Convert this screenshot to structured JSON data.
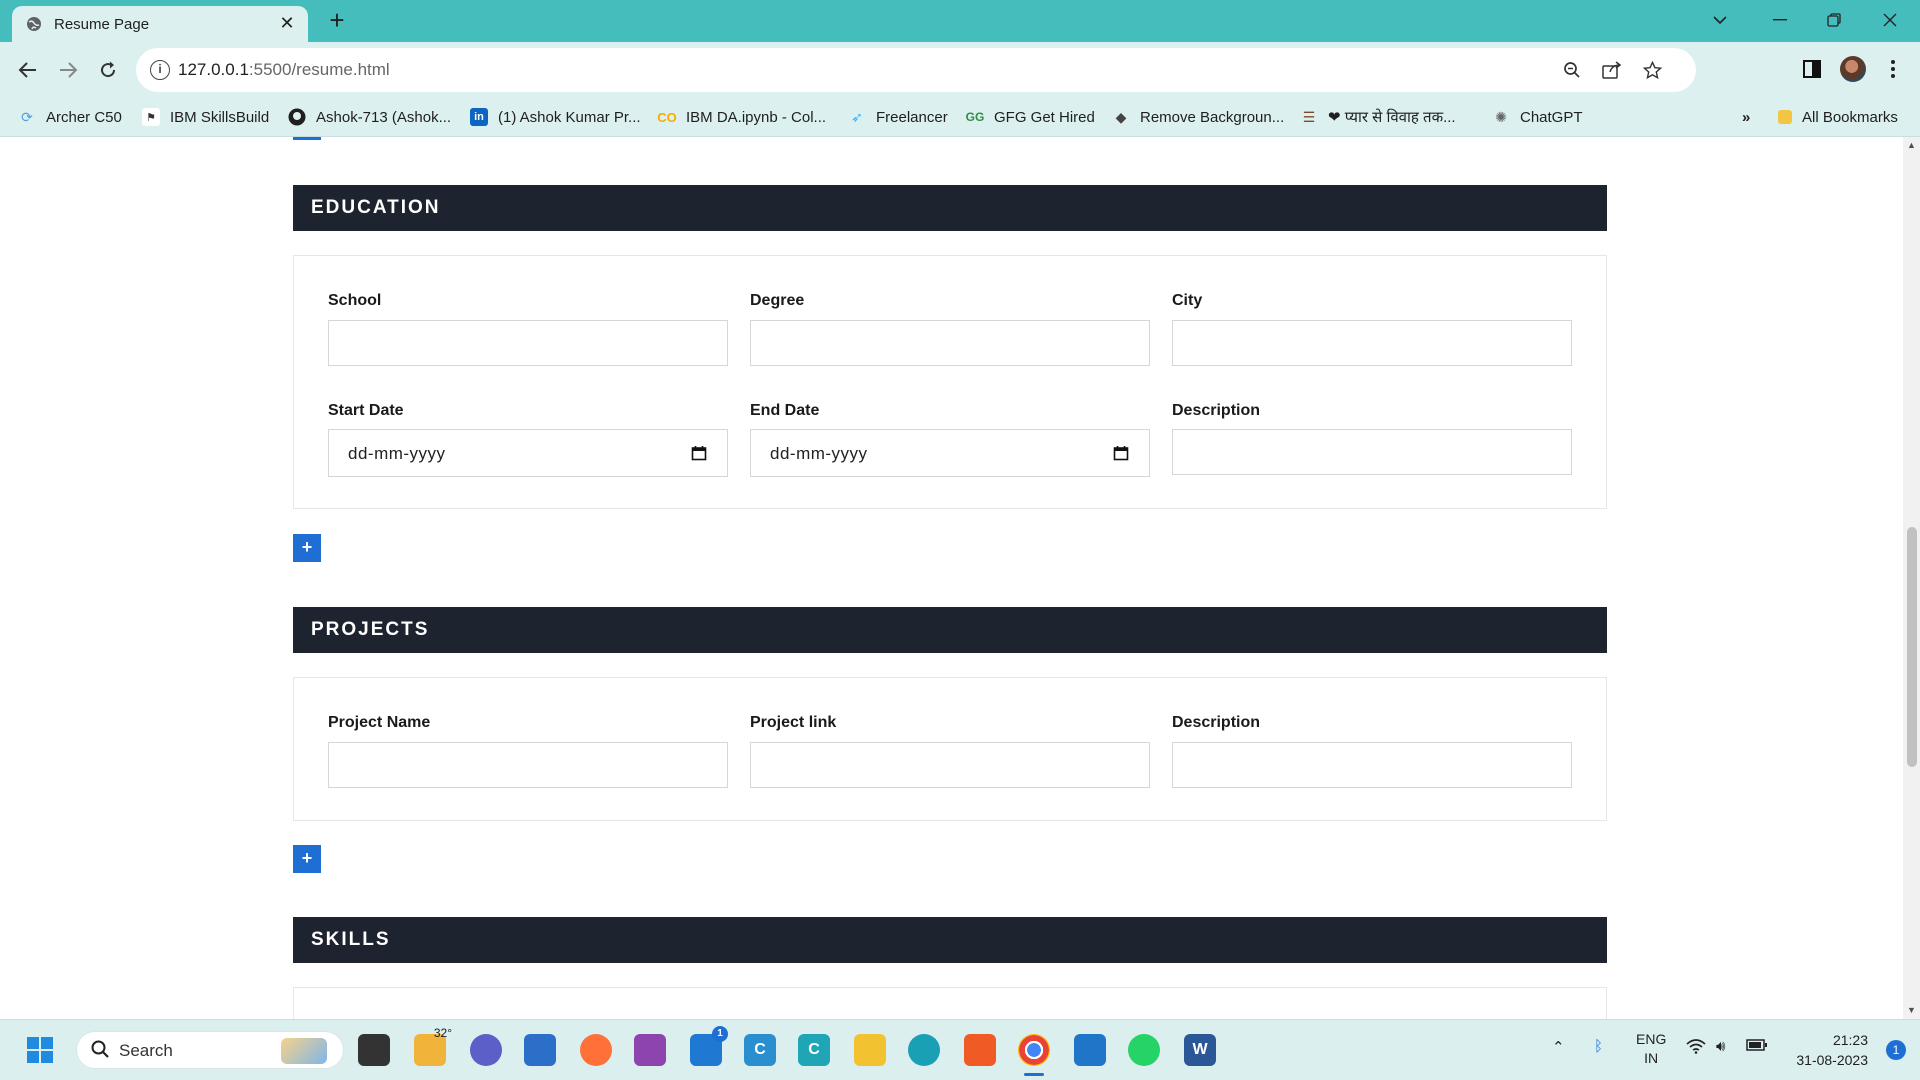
{
  "browser": {
    "tab_title": "Resume Page",
    "new_tab_symbol": "+",
    "url_host": "127.0.0.1",
    "url_path": ":5500/resume.html",
    "bookmarks": [
      {
        "label": "Archer C50",
        "icon": "tplink-icon"
      },
      {
        "label": "IBM SkillsBuild",
        "icon": "ibm-icon"
      },
      {
        "label": "Ashok-713 (Ashok...",
        "icon": "github-icon"
      },
      {
        "label": "(1) Ashok Kumar Pr...",
        "icon": "linkedin-icon"
      },
      {
        "label": "IBM DA.ipynb - Col...",
        "icon": "colab-icon"
      },
      {
        "label": "Freelancer",
        "icon": "freelancer-icon"
      },
      {
        "label": "GFG Get Hired",
        "icon": "gfg-icon"
      },
      {
        "label": "Remove Backgroun...",
        "icon": "removebg-icon"
      },
      {
        "label": "❤ प्यार से विवाह तक...",
        "icon": "book-icon"
      },
      {
        "label": "ChatGPT",
        "icon": "chatgpt-icon"
      }
    ],
    "more_bookmarks": "»",
    "all_bookmarks": "All Bookmarks"
  },
  "education": {
    "heading": "EDUCATION",
    "labels": {
      "school": "School",
      "degree": "Degree",
      "city": "City",
      "start_date": "Start Date",
      "end_date": "End Date",
      "description": "Description"
    },
    "date_placeholder": "dd-mm-yyyy",
    "add_label": "+"
  },
  "projects": {
    "heading": "PROJECTS",
    "labels": {
      "name": "Project Name",
      "link": "Project link",
      "description": "Description"
    },
    "add_label": "+"
  },
  "skills": {
    "heading": "SKILLS"
  },
  "taskbar": {
    "search_label": "Search",
    "weather_temp": "32°",
    "mail_badge": "1",
    "lang_line1": "ENG",
    "lang_line2": "IN",
    "time": "21:23",
    "date": "31-08-2023",
    "notification_count": "1"
  },
  "colors": {
    "tabbar": "#45bdbd",
    "toolbar": "#dcf0f0",
    "section_header": "#1e2330",
    "accent": "#1f6ed4"
  }
}
